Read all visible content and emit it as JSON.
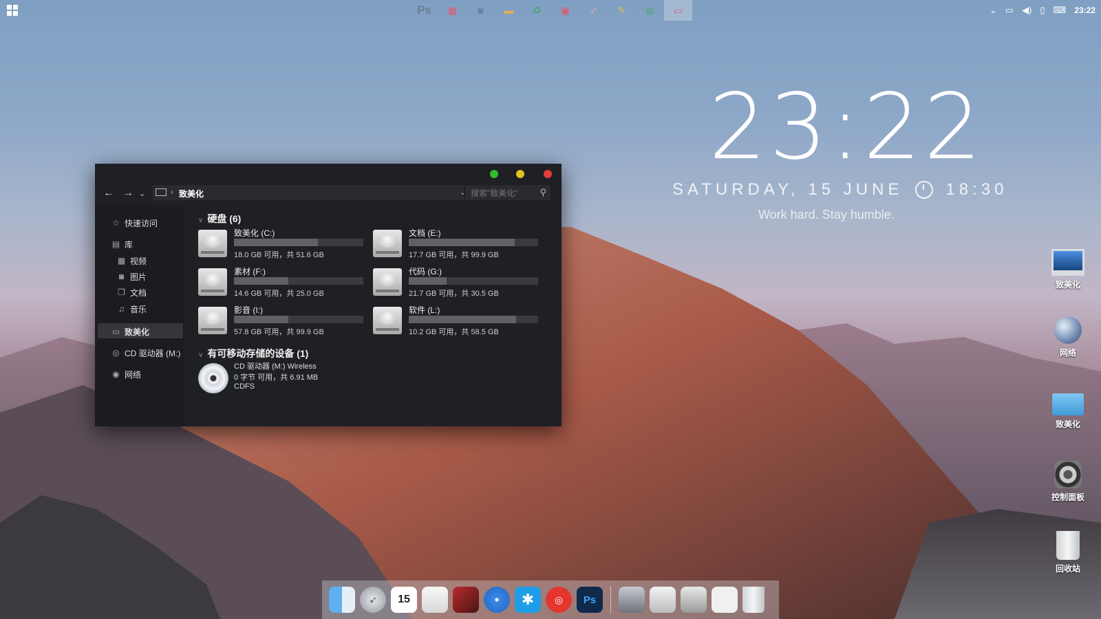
{
  "desktop": {
    "clock_time": "23:22",
    "date_text": "SATURDAY, 15 JUNE",
    "alarm_time": "18:30",
    "motto": "Work hard. Stay humble."
  },
  "taskbar": {
    "quick_launch": [
      "Ps",
      "",
      "",
      "",
      "",
      "",
      "",
      "",
      "",
      ""
    ],
    "tray_time": "23:22"
  },
  "explorer": {
    "breadcrumb": "致美化",
    "search_placeholder": "搜索\"致美化\"",
    "sidebar": {
      "quick_access": "快速访问",
      "library": "库",
      "videos": "视频",
      "pictures": "图片",
      "documents": "文档",
      "music": "音乐",
      "this_pc": "致美化",
      "cd_drive": "CD 驱动器 (M:)",
      "network": "网络"
    },
    "hard_disks_header": "硬盘 (6)",
    "drives": [
      {
        "name": "致美化 (C:)",
        "info": "18.0 GB 可用，共 51.6 GB",
        "used": 0.65
      },
      {
        "name": "文档 (E:)",
        "info": "17.7 GB 可用，共 99.9 GB",
        "used": 0.82
      },
      {
        "name": "素材 (F:)",
        "info": "14.6 GB 可用，共 25.0 GB",
        "used": 0.42
      },
      {
        "name": "代码 (G:)",
        "info": "21.7 GB 可用，共 30.5 GB",
        "used": 0.29
      },
      {
        "name": "影音 (I:)",
        "info": "57.8 GB 可用，共 99.9 GB",
        "used": 0.42
      },
      {
        "name": "软件 (L:)",
        "info": "10.2 GB 可用，共 58.5 GB",
        "used": 0.83
      }
    ],
    "removable_header": "有可移动存储的设备 (1)",
    "cd": {
      "line1": "CD 驱动器 (M:) Wireless",
      "line2": "0 字节 可用，共 6.91 MB",
      "line3": "CDFS"
    }
  },
  "desktop_icons": [
    "致美化",
    "网络",
    "致美化",
    "控制面板",
    "回收站"
  ],
  "dock_icons": [
    "finder-icon",
    "launchpad-icon",
    "calendar-icon",
    "notes-icon",
    "photo-booth-icon",
    "safari-icon",
    "star-app-icon",
    "netease-music-icon",
    "photoshop-icon",
    "automator-icon",
    "preview-icon",
    "slides-icon",
    "document-icon",
    "trash-icon"
  ],
  "dock_calendar_day": "15",
  "dock_ps_label": "Ps"
}
